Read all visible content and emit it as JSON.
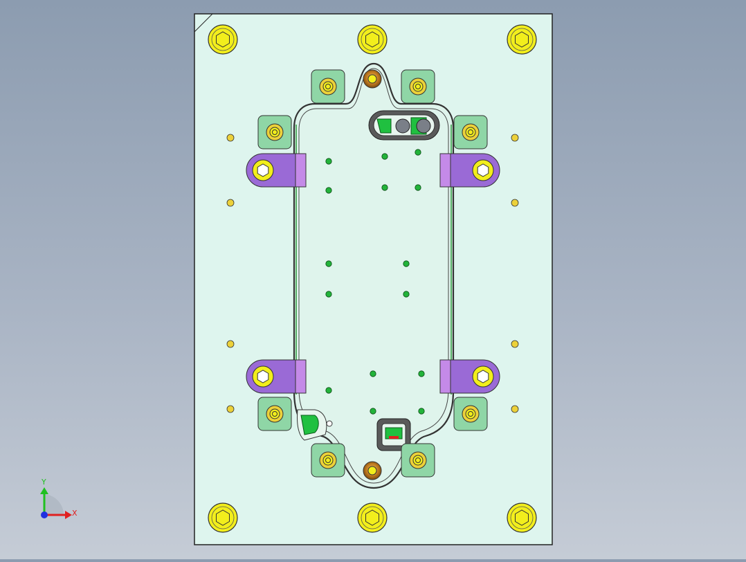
{
  "viewport": {
    "background_top": "#8c9cb0",
    "background_bottom": "#c5ccd6"
  },
  "model": {
    "plate_fill": "#def5ee",
    "outline": "#222222",
    "bolt_fill": "#f2ee1c",
    "pin_fill": "#ecd13a",
    "guide_fill": "#8fd6a6",
    "clamp_fill": "#9a6ad6",
    "dot_fill": "#22b33a",
    "bushing_fill": "#c07a20"
  },
  "triad": {
    "x_label": "X",
    "y_label": "Y",
    "x_color": "#e02020",
    "y_color": "#20c020",
    "z_color": "#2030e0"
  },
  "icons": [
    "hex-socket-bolt-icon",
    "dowel-pin-icon",
    "coordinate-triad-icon"
  ]
}
